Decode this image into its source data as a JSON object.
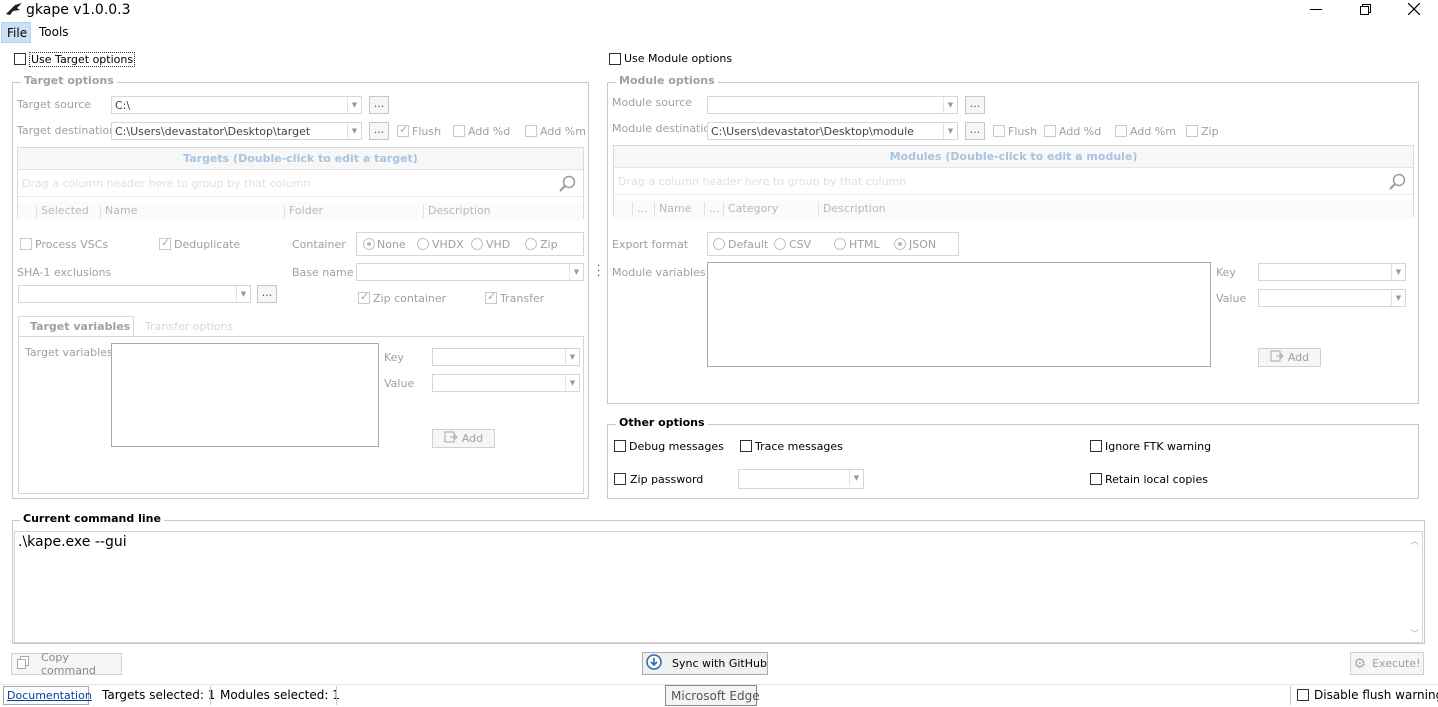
{
  "app": {
    "title": "gkape v1.0.0.3"
  },
  "menu": [
    "File",
    "Tools"
  ],
  "target": {
    "use_label": "Use Target options",
    "group_title": "Target options",
    "source_label": "Target source",
    "source_value": "C:\\",
    "dest_label": "Target destination",
    "dest_value": "C:\\Users\\devastator\\Desktop\\target",
    "flush": "Flush",
    "add_d": "Add %d",
    "add_m": "Add %m",
    "grid_title": "Targets (Double-click to edit a target)",
    "group_hint": "Drag a column header here to group by that column",
    "columns": [
      "Selected",
      "Name",
      "Folder",
      "Description"
    ],
    "process_vscs": "Process VSCs",
    "deduplicate": "Deduplicate",
    "container_label": "Container",
    "container_options": [
      "None",
      "VHDX",
      "VHD",
      "Zip"
    ],
    "sha1_label": "SHA-1 exclusions",
    "base_name_label": "Base name",
    "zip_container": "Zip container",
    "transfer": "Transfer",
    "tabs": [
      "Target variables",
      "Transfer options"
    ],
    "vars_label": "Target variables",
    "key_label": "Key",
    "value_label": "Value",
    "add_label": "Add"
  },
  "module": {
    "use_label": "Use Module options",
    "group_title": "Module options",
    "source_label": "Module source",
    "source_value": "",
    "dest_label": "Module destination",
    "dest_value": "C:\\Users\\devastator\\Desktop\\module",
    "flush": "Flush",
    "add_d": "Add %d",
    "add_m": "Add %m",
    "zip": "Zip",
    "grid_title": "Modules (Double-click to edit a module)",
    "group_hint": "Drag a column header here to group by that column",
    "columns": [
      "...",
      "Name",
      "...",
      "Category",
      "Description"
    ],
    "export_label": "Export format",
    "export_options": [
      "Default",
      "CSV",
      "HTML",
      "JSON"
    ],
    "vars_label": "Module variables",
    "key_label": "Key",
    "value_label": "Value",
    "add_label": "Add"
  },
  "other": {
    "group_title": "Other options",
    "debug": "Debug messages",
    "trace": "Trace messages",
    "ignore_ftk": "Ignore FTK warning",
    "zip_password": "Zip password",
    "retain": "Retain local copies"
  },
  "cmd": {
    "group_title": "Current command line",
    "value": ".\\kape.exe --gui"
  },
  "buttons": {
    "copy": "Copy command",
    "sync": "Sync with GitHub",
    "execute": "Execute!"
  },
  "tooltip": "Microsoft Edge",
  "status": {
    "documentation": "Documentation",
    "targets_selected": "Targets selected: 1",
    "modules_selected": "Modules selected: 1",
    "disable_flush": "Disable flush warnings"
  }
}
